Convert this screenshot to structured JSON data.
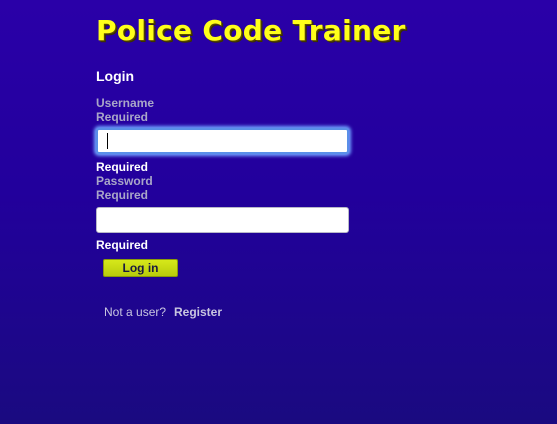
{
  "app": {
    "title": "Police Code Trainer",
    "title_color": "#ffff1a"
  },
  "login": {
    "heading": "Login",
    "username": {
      "label": "Username",
      "required_above": "Required",
      "value": "",
      "required_below": "Required",
      "focused": true
    },
    "password": {
      "label": "Password",
      "required_above": "Required",
      "value": "",
      "required_below": "Required"
    },
    "submit_label": "Log in",
    "submit_color": "#c8dc10"
  },
  "footer": {
    "prompt": "Not a user?",
    "register_label": "Register"
  },
  "theme": {
    "background": "#22009c",
    "label_color": "#a9a6c8"
  }
}
